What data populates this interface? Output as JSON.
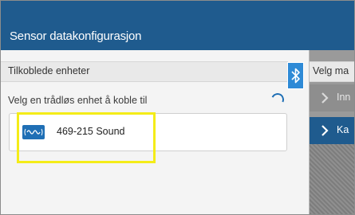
{
  "window": {
    "title": "Sensor datakonfigurasjon"
  },
  "connected_devices": {
    "header": "Tilkoblede enheter",
    "select_prompt": "Velg en trådløs enhet å koble til",
    "devices": [
      {
        "label": "469-215 Sound",
        "icon": "sound-sensor-icon"
      }
    ]
  },
  "bluetooth_tab": {
    "icon": "bluetooth-icon"
  },
  "right_panel": {
    "header": "Velg ma",
    "items": [
      {
        "label": "Inn",
        "state": "inactive",
        "icon": "chevron-right-icon"
      },
      {
        "label": "Ka",
        "state": "active",
        "icon": "chevron-right-icon"
      }
    ]
  },
  "colors": {
    "title_bar": "#1f5b8e",
    "accent": "#1f6fb5",
    "highlight": "#f4ec18",
    "panel_bg": "#f4f4f4"
  }
}
